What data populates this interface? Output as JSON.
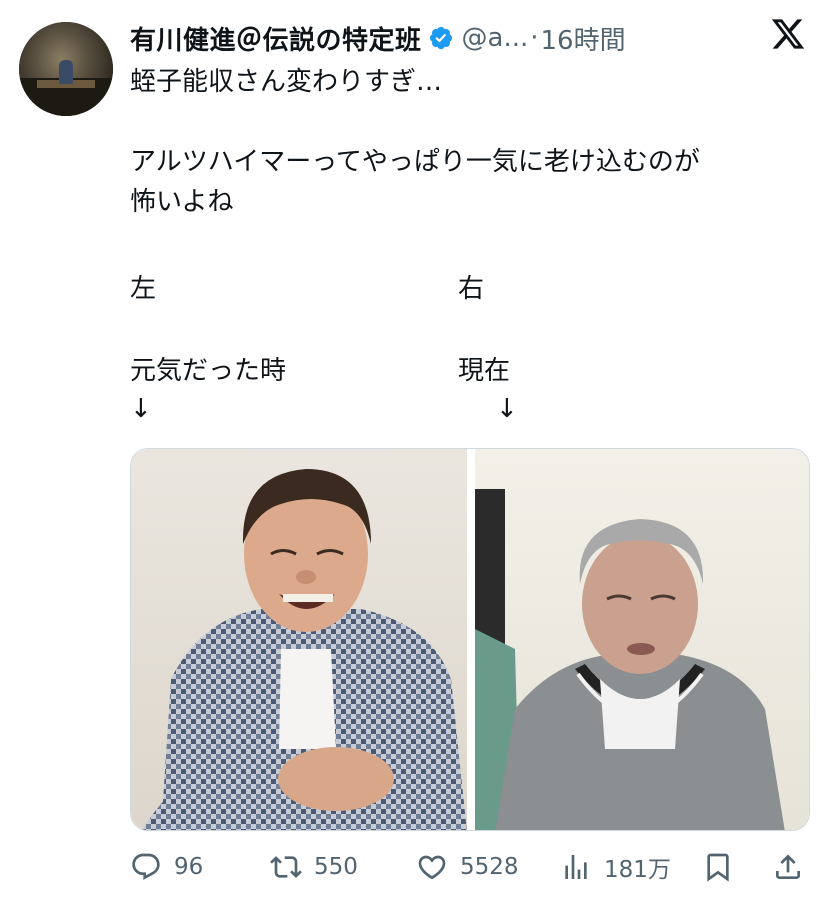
{
  "tweet": {
    "display_name": "有川健進＠伝説の特定班",
    "handle": "@a...",
    "separator": "·",
    "time": "16時間",
    "lines": [
      "蛭子能収さん変わりすぎ…",
      "",
      "アルツハイマーってやっぱり一気に老け込むのが",
      "怖いよね"
    ],
    "left_col": {
      "label": "左",
      "caption": "元気だった時",
      "arrow": "↓"
    },
    "right_col": {
      "label": "右",
      "caption": "現在",
      "arrow": "↓"
    }
  },
  "icons": {
    "verified": "verified-badge-icon",
    "platform": "x-logo-icon",
    "reply": "reply-icon",
    "retweet": "retweet-icon",
    "like": "heart-icon",
    "views": "analytics-icon",
    "bookmark": "bookmark-icon",
    "share": "share-icon"
  },
  "actions": {
    "replies": "96",
    "retweets": "550",
    "likes": "5528",
    "views": "181万"
  },
  "colors": {
    "verified_blue": "#1d9bf0",
    "text": "#0f1419",
    "secondary": "#536471"
  }
}
